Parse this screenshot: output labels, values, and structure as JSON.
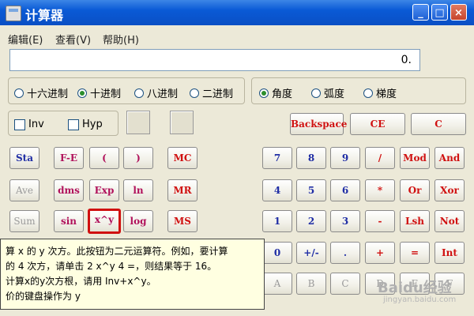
{
  "window": {
    "title": "计算器"
  },
  "titlebar_buttons": {
    "minimize": "_",
    "maximize": "□",
    "close": "×"
  },
  "menu": [
    "编辑(E)",
    "查看(V)",
    "帮助(H)"
  ],
  "display": {
    "value": "0."
  },
  "number_base": {
    "options": [
      "十六进制",
      "十进制",
      "八进制",
      "二进制"
    ],
    "selected": "十进制"
  },
  "angle_unit": {
    "options": [
      "角度",
      "弧度",
      "梯度"
    ],
    "selected": "角度"
  },
  "checks": {
    "inv": "Inv",
    "hyp": "Hyp"
  },
  "edit_buttons": {
    "backspace": "Backspace",
    "ce": "CE",
    "c": "C"
  },
  "sci_buttons": [
    [
      "Sta",
      "F-E",
      "(",
      ")"
    ],
    [
      "Ave",
      "dms",
      "Exp",
      "ln"
    ],
    [
      "Sum",
      "sin",
      "x^y",
      "log"
    ]
  ],
  "memory_buttons": [
    "MC",
    "MR",
    "MS"
  ],
  "keypad": [
    [
      "7",
      "8",
      "9",
      "/",
      "Mod",
      "And"
    ],
    [
      "4",
      "5",
      "6",
      "*",
      "Or",
      "Xor"
    ],
    [
      "1",
      "2",
      "3",
      "-",
      "Lsh",
      "Not"
    ],
    [
      "0",
      "+/-",
      ".",
      "+",
      "=",
      "Int"
    ]
  ],
  "hex_keys": [
    "A",
    "B",
    "C",
    "D",
    "E",
    "F"
  ],
  "tooltip": {
    "line1": "算 x 的 y 次方。此按钮为二元运算符。例如，要计算",
    "line2": "的 4 次方，请单击 2 x^y 4 =，则结果等于 16。",
    "line3": "计算x的y次方根，请用 Inv+x^y。",
    "line4": "价的键盘操作为 y"
  },
  "watermark": {
    "text": "Baidu经验",
    "sub": "jingyan.baidu.com"
  }
}
